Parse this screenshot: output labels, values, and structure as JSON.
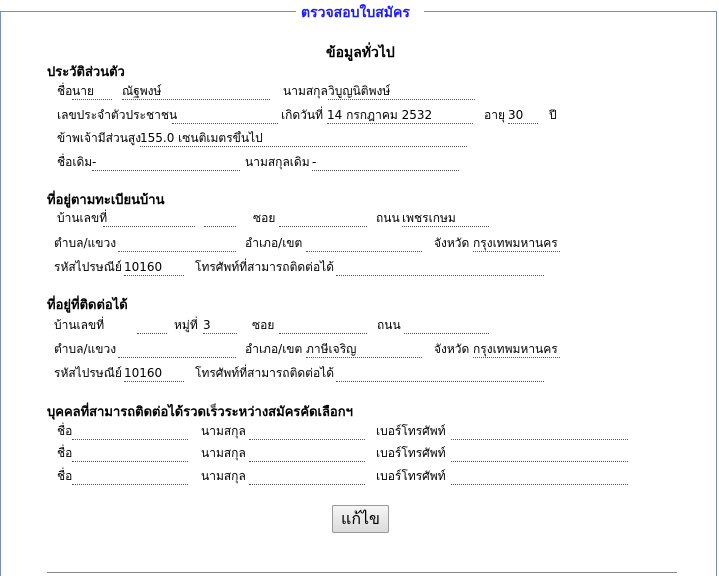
{
  "legend": "ตรวจสอบใบสมัคร",
  "title": "ข้อมูลทั่วไป",
  "personal": {
    "heading": "ประวัติส่วนตัว",
    "name_label": "ชื่อ",
    "name_prefix": "นาย",
    "first_name": "ณัฐพงษ์",
    "surname_label": "นามสกุล",
    "surname": "วิบูญนิติพงษ์",
    "id_label": "เลขประจำตัวประชาชน",
    "id_value": "",
    "birth_label": "เกิดวันที่",
    "birth_value": "14 กรกฎาคม 2532",
    "age_label": "อายุ",
    "age_value": "30",
    "age_unit": "ปี",
    "height_label": "ข้าพเจ้ามีส่วนสูง",
    "height_value": "155.0 เซนติเมตรขึ้นไป",
    "old_name_label": "ชื่อเดิม",
    "old_name_value": "-",
    "old_surname_label": "นามสกุลเดิม",
    "old_surname_value": "-"
  },
  "registered_address": {
    "heading": "ที่อยู่ตามทะเบียนบ้าน",
    "house_no_label": "บ้านเลขที่",
    "house_no_value": "",
    "moo_value": "",
    "soi_label": "ซอย",
    "soi_value": "",
    "road_label": "ถนน",
    "road_value": "เพชรเกษม",
    "subdistrict_label": "ตำบล/แขวง",
    "subdistrict_value": "",
    "district_label": "อำเภอ/เขต",
    "district_value": "",
    "province_label": "จังหวัด",
    "province_value": "กรุงเทพมหานคร",
    "postcode_label": "รหัสไปรษณีย์",
    "postcode_value": "10160",
    "phone_label": "โทรศัพท์ที่สามารถติดต่อได้",
    "phone_value": ""
  },
  "contact_address": {
    "heading": "ที่อยู่ที่ติดต่อได้",
    "house_no_label": "บ้านเลขที่",
    "house_no_value": "",
    "moo_label": "หมู่ที่",
    "moo_value": "3",
    "soi_label": "ซอย",
    "soi_value": "",
    "road_label": "ถนน",
    "road_value": "",
    "subdistrict_label": "ตำบล/แขวง",
    "subdistrict_value": "",
    "district_label": "อำเภอ/เขต",
    "district_value": "ภาษีเจริญ",
    "province_label": "จังหวัด",
    "province_value": "กรุงเทพมหานคร",
    "postcode_label": "รหัสไปรษณีย์",
    "postcode_value": "10160",
    "phone_label": "โทรศัพท์ที่สามารถติดต่อได้",
    "phone_value": ""
  },
  "emergency": {
    "heading": "บุคคลที่สามารถติดต่อได้รวดเร็วระหว่างสมัครคัดเลือกฯ",
    "name_label": "ชื่อ",
    "surname_label": "นามสกุล",
    "phone_label": "เบอร์โทรศัพท์",
    "rows": [
      {
        "name": "",
        "surname": "",
        "phone": ""
      },
      {
        "name": "",
        "surname": "",
        "phone": ""
      },
      {
        "name": "",
        "surname": "",
        "phone": ""
      }
    ]
  },
  "edit_button": "แก้ไข"
}
